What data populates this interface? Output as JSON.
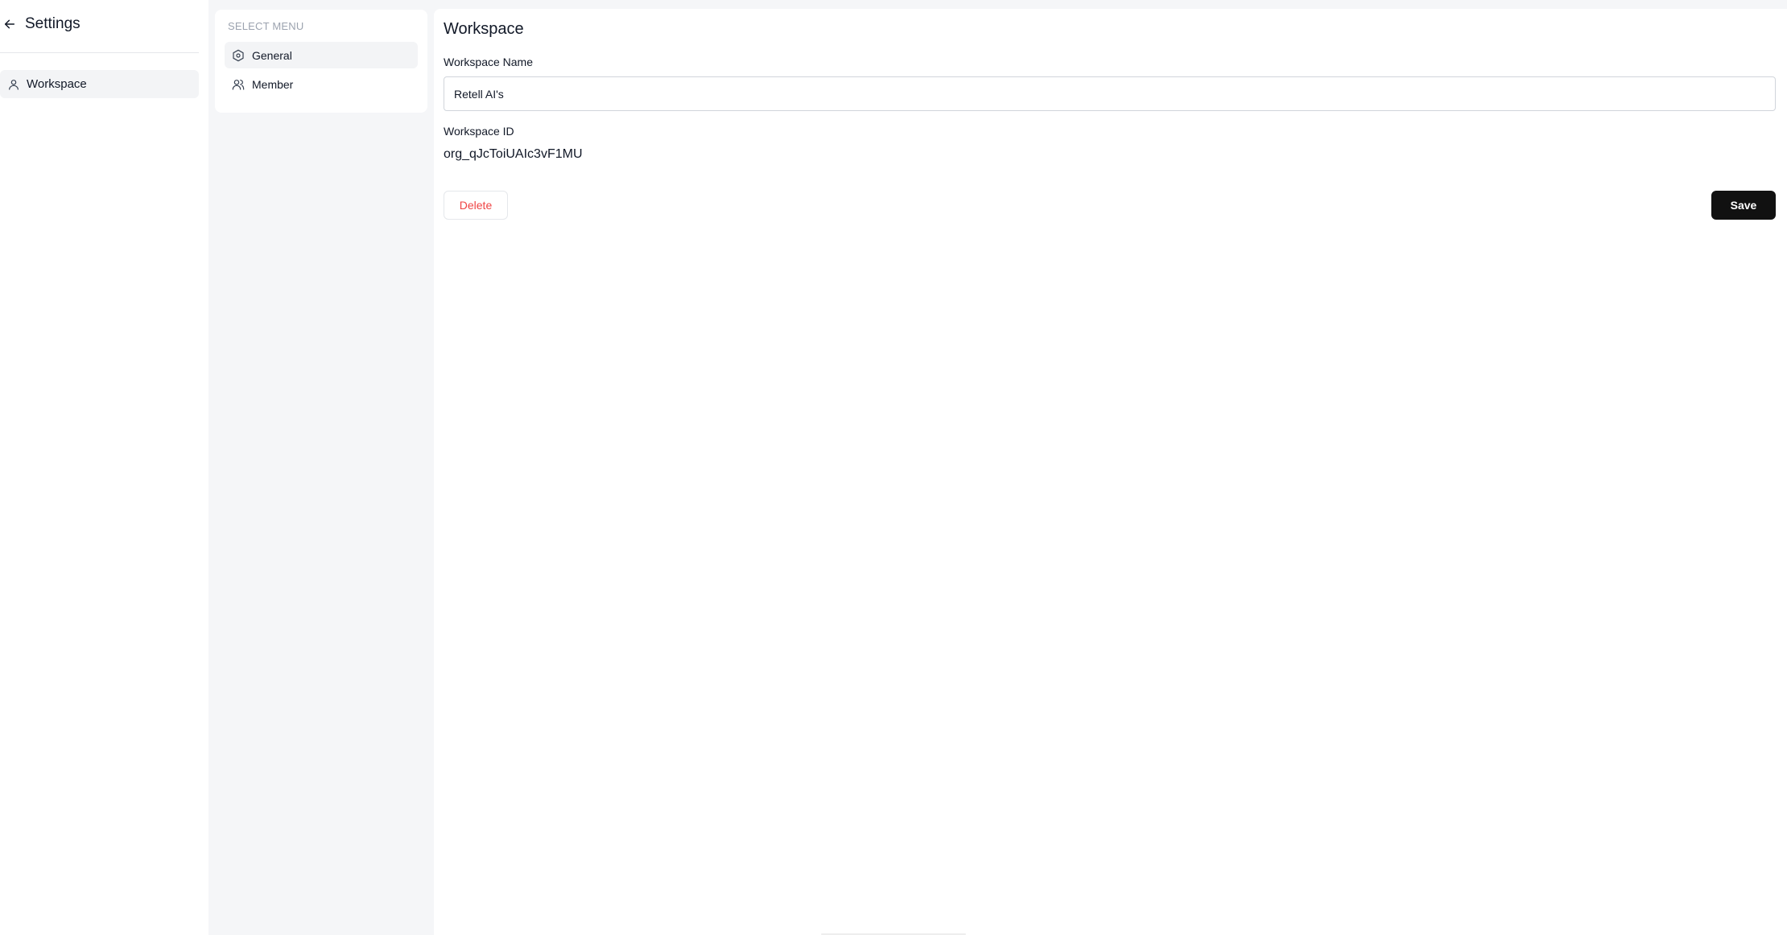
{
  "sidebar": {
    "title": "Settings",
    "back_icon": "arrow-left-icon",
    "items": [
      {
        "label": "Workspace",
        "icon": "user-icon",
        "active": true
      }
    ]
  },
  "menu": {
    "heading": "SELECT MENU",
    "items": [
      {
        "label": "General",
        "icon": "hexagon-settings-icon",
        "active": true
      },
      {
        "label": "Member",
        "icon": "users-icon",
        "active": false
      }
    ]
  },
  "main": {
    "title": "Workspace",
    "workspace_name_label": "Workspace Name",
    "workspace_name_value": "Retell AI's",
    "workspace_id_label": "Workspace ID",
    "workspace_id_value": "org_qJcToiUAIc3vF1MU",
    "delete_label": "Delete",
    "save_label": "Save"
  },
  "colors": {
    "accent_dark": "#111111",
    "danger": "#ef4444",
    "muted_bg": "#f5f6f8",
    "active_item_bg": "#f3f4f6"
  }
}
